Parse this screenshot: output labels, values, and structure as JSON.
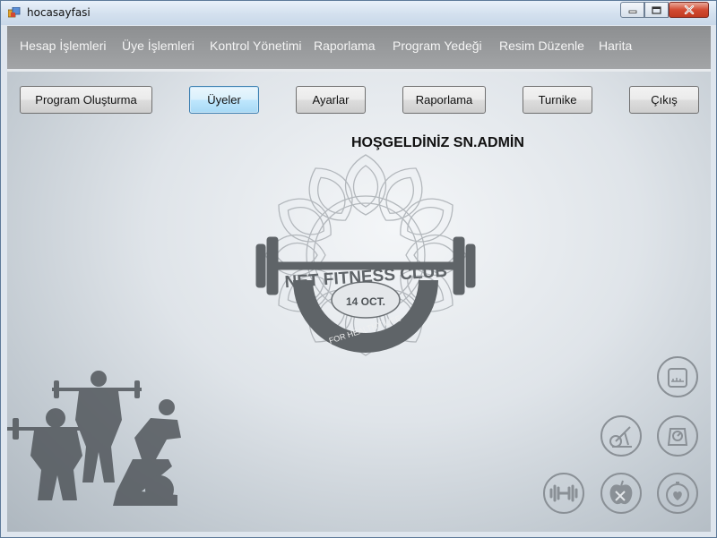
{
  "window": {
    "title": "hocasayfasi",
    "controls": {
      "minimize": "minimize-icon",
      "maximize": "maximize-icon",
      "close": "close-icon"
    }
  },
  "menu": {
    "items": [
      "Hesap İşlemleri",
      "Üye İşlemleri",
      "Kontrol Yönetimi",
      "Raporlama",
      "Program Yedeği",
      "Resim Düzenle",
      "Harita"
    ]
  },
  "toolbar": {
    "buttons": [
      "Program Oluşturma",
      "Üyeler",
      "Ayarlar",
      "Raporlama",
      "Turnike",
      "Çıkış"
    ],
    "focused": "Üyeler"
  },
  "welcome_text": "HOŞGELDİNİZ SN.ADMİN",
  "logo": {
    "name": "NET FITNESS CLUB",
    "date": "14 OCT.",
    "tagline": "FOR HEALTHY LIFE"
  },
  "fitness_icons": [
    "scale-tape-icon",
    "exercise-bike-icon",
    "weight-scale-icon",
    "dumbbell-icon",
    "apple-diet-icon",
    "heart-stopwatch-icon"
  ],
  "colors": {
    "menubar": "#9a9c9e",
    "focus_border": "#3c7fb1",
    "close_button": "#d24a32"
  }
}
